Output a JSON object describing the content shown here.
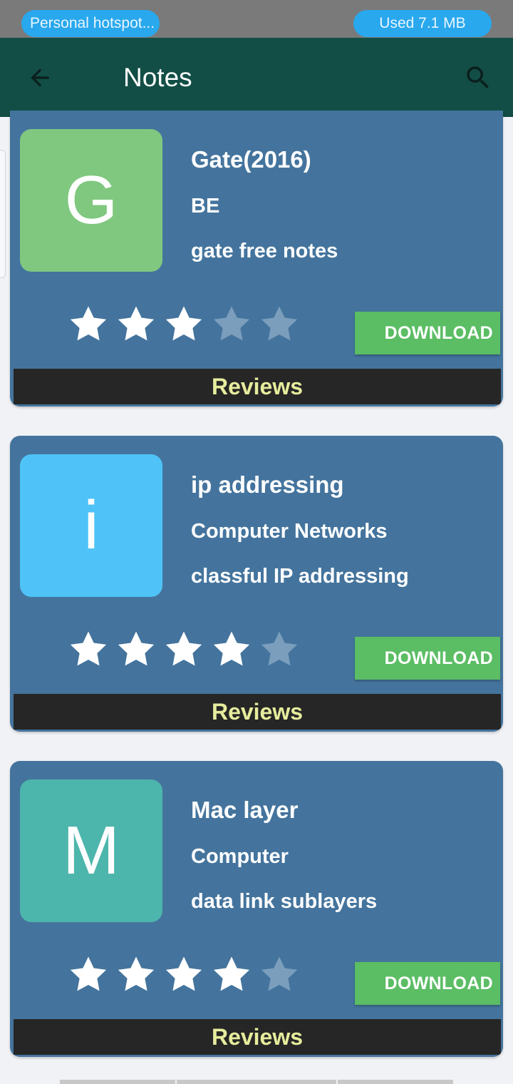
{
  "status_bar": {
    "hotspot_label": "Personal hotspot...",
    "data_usage": "Used  7.1 MB"
  },
  "app_bar": {
    "title": "Notes",
    "back_icon": "arrow-left-icon",
    "search_icon": "search-icon"
  },
  "colors": {
    "app_bar_bg": "#124e46",
    "card_bg": "#44749d",
    "download_bg": "#5bbd64",
    "reviews_bg": "#262626",
    "reviews_text": "#e6ec9c",
    "star_filled": "#ffffff",
    "star_empty": "#7b9ebd"
  },
  "notes": [
    {
      "letter": "G",
      "thumb_color": "#80c880",
      "title": "Gate(2016)",
      "subject": "BE",
      "description": "gate free notes",
      "rating": 3,
      "max_rating": 5,
      "download_label": "DOWNLOAD",
      "reviews_label": "Reviews"
    },
    {
      "letter": "i",
      "thumb_color": "#4fc3f7",
      "title": "ip addressing",
      "subject": "Computer Networks",
      "description": "classful IP addressing",
      "rating": 4,
      "max_rating": 5,
      "download_label": "DOWNLOAD",
      "reviews_label": "Reviews"
    },
    {
      "letter": "M",
      "thumb_color": "#4db6ac",
      "title": "Mac layer",
      "subject": "Computer",
      "description": "data link sublayers",
      "rating": 4,
      "max_rating": 5,
      "download_label": "DOWNLOAD",
      "reviews_label": "Reviews"
    }
  ]
}
